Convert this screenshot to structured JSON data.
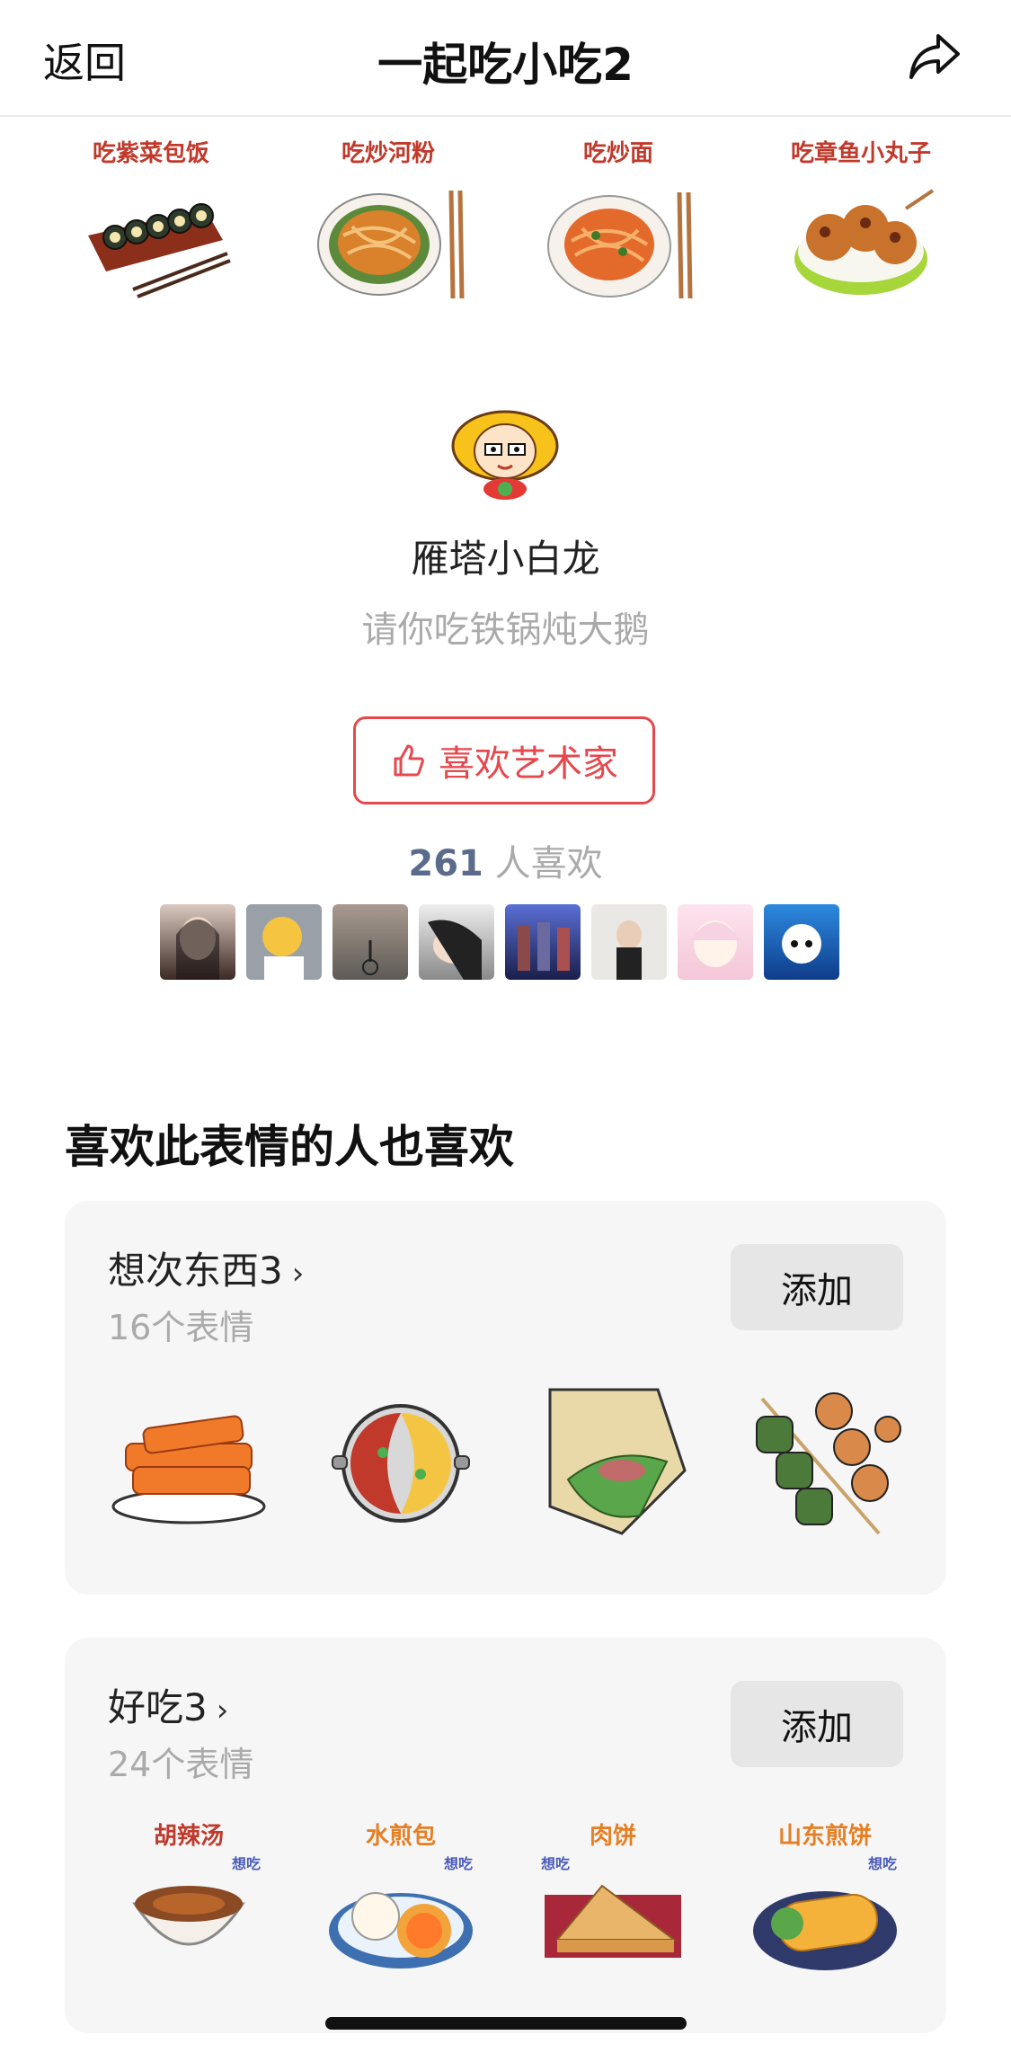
{
  "nav": {
    "back_label": "返回",
    "title": "一起吃小吃2",
    "share_icon": "share-arrow-icon"
  },
  "food_strip": [
    {
      "caption": "吃紫菜包饭",
      "icon": "kimbap-icon"
    },
    {
      "caption": "吃炒河粉",
      "icon": "fried-rice-noodles-icon"
    },
    {
      "caption": "吃炒面",
      "icon": "fried-noodles-icon"
    },
    {
      "caption": "吃章鱼小丸子",
      "icon": "takoyaki-icon"
    }
  ],
  "artist": {
    "avatar_icon": "artist-avatar-icon",
    "name": "雁塔小白龙",
    "signature": "请你吃铁锅炖大鹅",
    "like_button": "喜欢艺术家",
    "like_count": "261",
    "like_count_suffix": " 人喜欢",
    "likers": [
      "liker-avatar-1",
      "liker-avatar-2",
      "liker-avatar-3",
      "liker-avatar-4",
      "liker-avatar-5",
      "liker-avatar-6",
      "liker-avatar-7",
      "liker-avatar-8"
    ]
  },
  "section": {
    "title": "喜欢此表情的人也喜欢",
    "packs": [
      {
        "name": "想次东西3",
        "count": "16个表情",
        "add_label": "添加",
        "stickers": [
          {
            "icon": "fried-snack-sticker"
          },
          {
            "icon": "hotpot-sticker"
          },
          {
            "icon": "wrap-sticker"
          },
          {
            "icon": "skewers-sticker"
          }
        ]
      },
      {
        "name": "好吃3",
        "count": "24个表情",
        "add_label": "添加",
        "stickers": [
          {
            "caption": "胡辣汤",
            "sub": "想吃",
            "icon": "hot-pepper-soup-sticker",
            "color": "#c0392b"
          },
          {
            "caption": "水煎包",
            "sub": "想吃",
            "icon": "pan-fried-bun-sticker",
            "color": "#e67e22"
          },
          {
            "caption": "肉饼",
            "sub": "想吃",
            "icon": "meat-pie-sticker",
            "color": "#e67e22"
          },
          {
            "caption": "山东煎饼",
            "sub": "想吃",
            "icon": "shandong-pancake-sticker",
            "color": "#e67e22"
          }
        ]
      }
    ]
  },
  "colors": {
    "accent": "#e5484d",
    "count_num": "#5a6b8c",
    "card_bg": "#f6f6f7"
  }
}
